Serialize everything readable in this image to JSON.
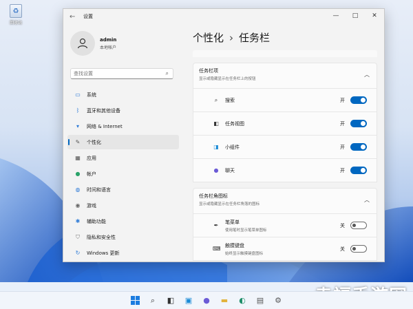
{
  "desktop": {
    "recycle_label": "回收站",
    "watermark": "幸福手游网"
  },
  "window": {
    "title": "设置",
    "controls": [
      "—",
      "□",
      "✕"
    ]
  },
  "profile": {
    "name": "admin",
    "type": "本地帐户"
  },
  "search": {
    "placeholder": "查找设置"
  },
  "sidebar": {
    "items": [
      {
        "label": "系统",
        "icon": "monitor-icon"
      },
      {
        "label": "蓝牙和其他设备",
        "icon": "bluetooth-icon"
      },
      {
        "label": "网络 & Internet",
        "icon": "wifi-icon"
      },
      {
        "label": "个性化",
        "icon": "brush-icon",
        "active": true
      },
      {
        "label": "应用",
        "icon": "apps-icon"
      },
      {
        "label": "帐户",
        "icon": "person-icon"
      },
      {
        "label": "时间和语言",
        "icon": "globe-icon"
      },
      {
        "label": "游戏",
        "icon": "gamepad-icon"
      },
      {
        "label": "辅助功能",
        "icon": "accessibility-icon"
      },
      {
        "label": "隐私和安全性",
        "icon": "shield-icon"
      },
      {
        "label": "Windows 更新",
        "icon": "update-icon"
      }
    ]
  },
  "breadcrumb": {
    "parent": "个性化",
    "separator": "›",
    "current": "任务栏"
  },
  "taskbar_items": {
    "title": "任务栏项",
    "desc": "显示或隐藏显示在任务栏上的按钮",
    "rows": [
      {
        "label": "搜索",
        "state": "开",
        "on": true,
        "icon": "search-icon"
      },
      {
        "label": "任务视图",
        "state": "开",
        "on": true,
        "icon": "task-view-icon"
      },
      {
        "label": "小组件",
        "state": "开",
        "on": true,
        "icon": "widgets-icon"
      },
      {
        "label": "聊天",
        "state": "开",
        "on": true,
        "icon": "chat-icon"
      }
    ]
  },
  "corner_icons": {
    "title": "任务栏角图标",
    "desc": "显示或隐藏显示在任务栏角落的图标",
    "rows": [
      {
        "label": "笔菜单",
        "desc": "使用笔时显示笔菜单图标",
        "state": "关",
        "on": false,
        "icon": "pen-icon"
      },
      {
        "label": "触摸键盘",
        "desc": "始终显示触摸键盘图标",
        "state": "关",
        "on": false,
        "icon": "keyboard-icon"
      }
    ]
  },
  "colors": {
    "accent": "#0067c0"
  }
}
